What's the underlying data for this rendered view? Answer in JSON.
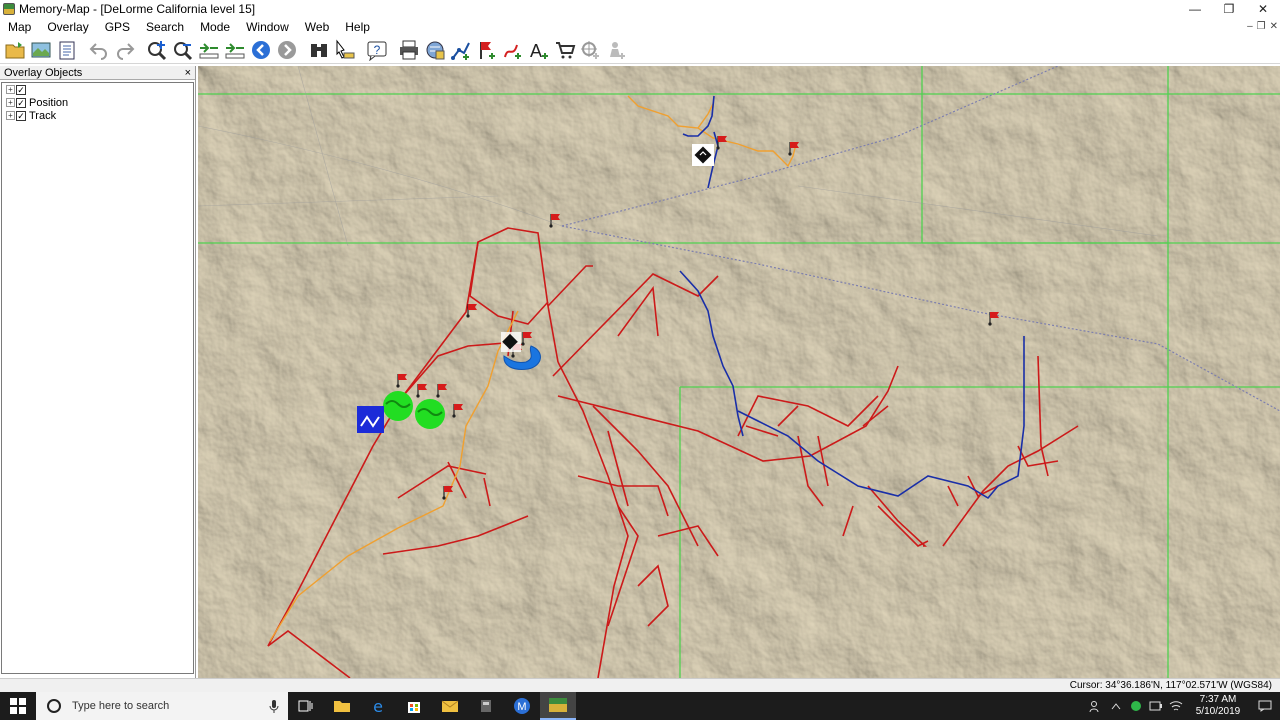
{
  "window": {
    "title": "Memory-Map - [DeLorme California level 15]",
    "minimize_glyph": "—",
    "restore_glyph": "❐",
    "close_glyph": "✕"
  },
  "menu": {
    "items": [
      "Map",
      "Overlay",
      "GPS",
      "Search",
      "Mode",
      "Window",
      "Web",
      "Help"
    ],
    "mdi_glyphs": [
      "–",
      "❐",
      "✕"
    ]
  },
  "toolbar": {
    "buttons": [
      "open-folder-icon",
      "map-icon",
      "properties-icon",
      "undo-icon",
      "redo-icon",
      "zoom-in-icon",
      "zoom-out-icon",
      "scale-up-icon",
      "scale-down-icon",
      "back-icon",
      "forward-icon",
      "binoculars-icon",
      "edit-pointer-icon",
      "help-icon",
      "print-icon",
      "gps-icon",
      "new-route-icon",
      "new-mark-icon",
      "new-track-icon",
      "new-text-icon",
      "shop-icon",
      "position-icon",
      "person-icon"
    ]
  },
  "overlay_panel": {
    "title": "Overlay Objects",
    "close_glyph": "×",
    "tree": [
      {
        "label": "",
        "checked": true
      },
      {
        "label": "Position",
        "checked": true
      },
      {
        "label": "Track",
        "checked": true
      }
    ]
  },
  "status": {
    "cursor": "Cursor: 34°36.186'N, 117°02.571'W (WGS84)"
  },
  "taskbar": {
    "search_placeholder": "Type here to search",
    "time": "7:37 AM",
    "date": "5/10/2019"
  },
  "colors": {
    "terrain": "#e7e1d0",
    "grid_line": "#44cc44",
    "red_track": "#cc1a1a",
    "blue_track": "#1a2fa8",
    "orange_track": "#f0a030",
    "rail": "#7d7fae"
  }
}
